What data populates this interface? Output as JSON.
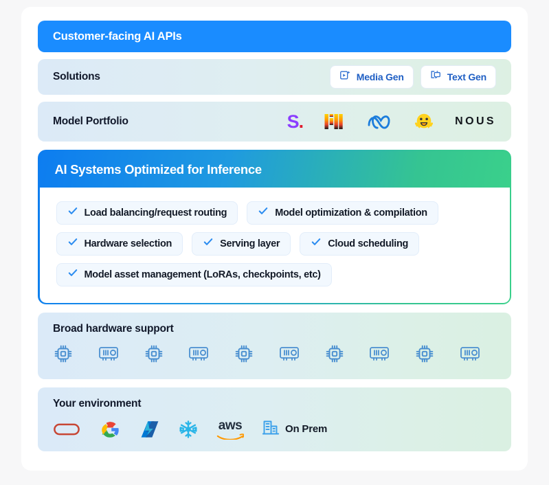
{
  "banner": {
    "title": "Customer-facing AI APIs"
  },
  "solutions": {
    "label": "Solutions",
    "chips": [
      {
        "label": "Media Gen",
        "icon": "media-gen-icon"
      },
      {
        "label": "Text Gen",
        "icon": "text-gen-icon"
      }
    ]
  },
  "model_portfolio": {
    "label": "Model Portfolio",
    "brands": [
      {
        "name": "stability-ai-logo",
        "text": "S."
      },
      {
        "name": "mistral-ai-logo",
        "text": "M"
      },
      {
        "name": "meta-logo",
        "text": ""
      },
      {
        "name": "hugging-face-logo",
        "text": ""
      },
      {
        "name": "nous-research-logo",
        "text": "NOUS"
      }
    ]
  },
  "ai_systems": {
    "title": "AI Systems Optimized for Inference",
    "features": [
      [
        "Load balancing/request routing",
        "Model optimization & compilation"
      ],
      [
        "Hardware selection",
        "Serving layer",
        "Cloud scheduling"
      ],
      [
        "Model asset management (LoRAs, checkpoints, etc)"
      ]
    ]
  },
  "hardware": {
    "title": "Broad hardware support",
    "icons": [
      "cpu-chip-icon",
      "gpu-card-icon",
      "cpu-chip-icon",
      "gpu-card-icon",
      "cpu-chip-icon",
      "gpu-card-icon",
      "cpu-chip-icon",
      "gpu-card-icon",
      "cpu-chip-icon",
      "gpu-card-icon"
    ]
  },
  "environment": {
    "title": "Your environment",
    "items": [
      {
        "name": "oracle-cloud-logo",
        "label": ""
      },
      {
        "name": "google-cloud-logo",
        "label": ""
      },
      {
        "name": "microsoft-azure-logo",
        "label": ""
      },
      {
        "name": "snowflake-logo",
        "label": ""
      },
      {
        "name": "aws-logo",
        "label": "aws"
      },
      {
        "name": "on-prem-icon",
        "label": "On Prem"
      }
    ]
  },
  "colors": {
    "banner_blue": "#1a8cff",
    "gradient_start": "#0d7df0",
    "gradient_end": "#3ad08b",
    "check_blue": "#2b8cf0",
    "chip_text_blue": "#1f5fc4",
    "hardware_icon_blue": "#4a8fd0",
    "text_dark": "#11182a"
  }
}
